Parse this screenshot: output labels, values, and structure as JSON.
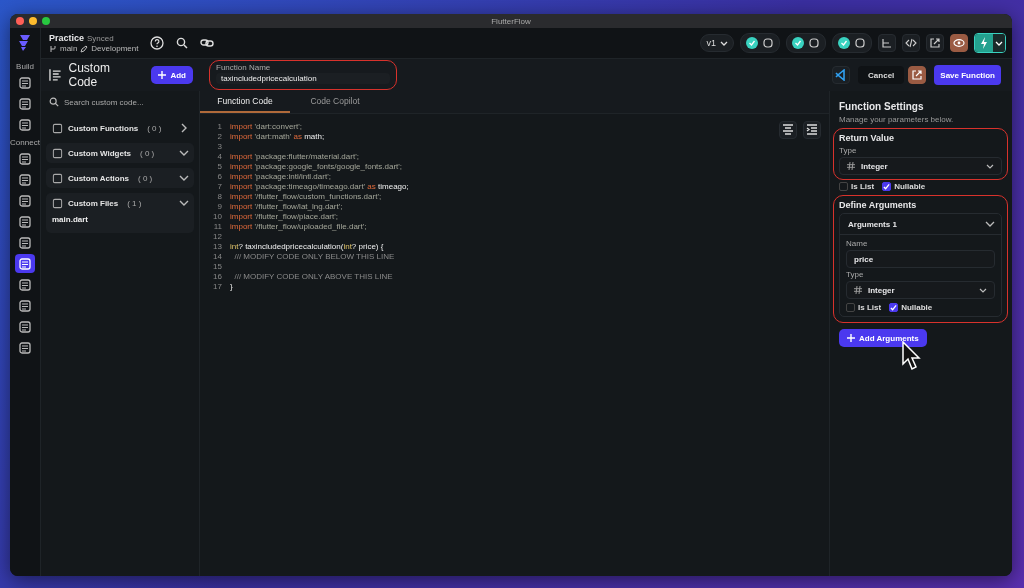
{
  "window": {
    "title": "FlutterFlow"
  },
  "project": {
    "name": "Practice",
    "sync_status": "Synced",
    "branch": "main",
    "environment": "Development"
  },
  "rail": [
    {
      "label": "Build",
      "items": [
        {
          "selected": false
        },
        {
          "selected": false
        },
        {
          "selected": false
        }
      ]
    },
    {
      "label": "Connect",
      "items": [
        {
          "selected": false
        },
        {
          "selected": false
        },
        {
          "selected": false
        },
        {
          "selected": false
        },
        {
          "selected": false
        },
        {
          "selected": true
        },
        {
          "selected": false
        },
        {
          "selected": false
        },
        {
          "selected": false
        },
        {
          "selected": false
        }
      ]
    }
  ],
  "toolbar": {
    "version": "v1",
    "status_checks": [
      {
        "ok": true
      },
      {
        "ok": true
      },
      {
        "ok": true
      }
    ]
  },
  "sidebar": {
    "title": "Custom Code",
    "add_button": "Add",
    "search": {
      "placeholder": "Search custom code..."
    },
    "groups": [
      {
        "name": "Custom Functions",
        "count": "( 0 )",
        "expanded": false
      },
      {
        "name": "Custom Widgets",
        "count": "( 0 )",
        "expanded": true
      },
      {
        "name": "Custom Actions",
        "count": "( 0 )",
        "expanded": true
      },
      {
        "name": "Custom Files",
        "count": "( 1 )",
        "expanded": true,
        "children": [
          {
            "name": "main.dart"
          }
        ]
      }
    ]
  },
  "function_name": {
    "label": "Function Name",
    "value": "taxincludedpricecalculation",
    "highlighted": true
  },
  "actions": {
    "cancel": "Cancel",
    "save": "Save Function"
  },
  "tabs": [
    {
      "label": "Function Code",
      "selected": true
    },
    {
      "label": "Code Copilot",
      "selected": false
    }
  ],
  "code": [
    {
      "number": "1",
      "tokens": [
        {
          "kind": "keyword",
          "text": "import"
        },
        {
          "kind": "string",
          "text": " 'dart:convert';"
        }
      ]
    },
    {
      "number": "2",
      "tokens": [
        {
          "kind": "keyword",
          "text": "import"
        },
        {
          "kind": "string",
          "text": " 'dart:math' "
        },
        {
          "kind": "keyword",
          "text": "as"
        },
        {
          "kind": "ident",
          "text": " math;"
        }
      ]
    },
    {
      "number": "3"
    },
    {
      "number": "4",
      "tokens": [
        {
          "kind": "keyword",
          "text": "import"
        },
        {
          "kind": "string",
          "text": " 'package:flutter/material.dart';"
        }
      ]
    },
    {
      "number": "5",
      "tokens": [
        {
          "kind": "keyword",
          "text": "import"
        },
        {
          "kind": "string",
          "text": " 'package:google_fonts/google_fonts.dart';"
        }
      ]
    },
    {
      "number": "6",
      "tokens": [
        {
          "kind": "keyword",
          "text": "import"
        },
        {
          "kind": "string",
          "text": " 'package:intl/intl.dart';"
        }
      ]
    },
    {
      "number": "7",
      "tokens": [
        {
          "kind": "keyword",
          "text": "import"
        },
        {
          "kind": "string",
          "text": " 'package:timeago/timeago.dart' "
        },
        {
          "kind": "keyword",
          "text": "as"
        },
        {
          "kind": "ident",
          "text": " timeago;"
        }
      ]
    },
    {
      "number": "8",
      "tokens": [
        {
          "kind": "keyword",
          "text": "import"
        },
        {
          "kind": "string",
          "text": " '/flutter_flow/custom_functions.dart';"
        }
      ]
    },
    {
      "number": "9",
      "tokens": [
        {
          "kind": "keyword",
          "text": "import"
        },
        {
          "kind": "string",
          "text": " '/flutter_flow/lat_lng.dart';"
        }
      ]
    },
    {
      "number": "10",
      "tokens": [
        {
          "kind": "keyword",
          "text": "import"
        },
        {
          "kind": "string",
          "text": " '/flutter_flow/place.dart';"
        }
      ]
    },
    {
      "number": "11",
      "tokens": [
        {
          "kind": "keyword",
          "text": "import"
        },
        {
          "kind": "string",
          "text": " '/flutter_flow/uploaded_file.dart';"
        }
      ]
    },
    {
      "number": "12"
    },
    {
      "number": "13",
      "tokens": [
        {
          "kind": "type",
          "text": "int"
        },
        {
          "kind": "ident",
          "text": "? taxincludedpricecalculation("
        },
        {
          "kind": "type",
          "text": "int"
        },
        {
          "kind": "ident",
          "text": "? price) {"
        }
      ]
    },
    {
      "number": "14",
      "tokens": [
        {
          "kind": "comment",
          "text": "  /// MODIFY CODE ONLY BELOW THIS LINE"
        }
      ]
    },
    {
      "number": "15"
    },
    {
      "number": "16",
      "tokens": [
        {
          "kind": "comment",
          "text": "  /// MODIFY CODE ONLY ABOVE THIS LINE"
        }
      ]
    },
    {
      "number": "17",
      "tokens": [
        {
          "kind": "ident",
          "text": "}"
        }
      ]
    }
  ],
  "settings": {
    "title": "Function Settings",
    "subtitle": "Manage your parameters below.",
    "return_value": {
      "title": "Return Value",
      "highlighted": true,
      "type_label": "Type",
      "type": "Integer",
      "is_list": {
        "label": "Is List",
        "checked": false
      },
      "nullable": {
        "label": "Nullable",
        "checked": true
      }
    },
    "arguments": {
      "title": "Define Arguments",
      "highlighted": true,
      "items": [
        {
          "title": "Arguments 1",
          "expanded": true,
          "name_label": "Name",
          "name": "price",
          "type_label": "Type",
          "type": "Integer",
          "is_list": {
            "label": "Is List",
            "checked": false
          },
          "nullable": {
            "label": "Nullable",
            "checked": true
          }
        }
      ]
    },
    "add_button": "Add Arguments"
  }
}
